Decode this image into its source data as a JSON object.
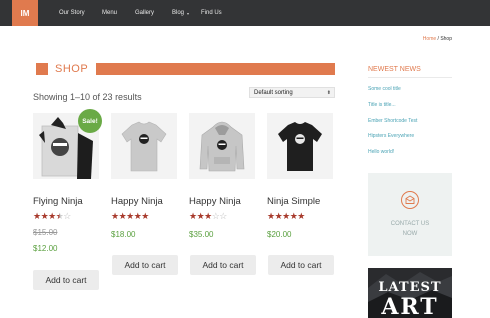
{
  "nav": {
    "logo": "IM",
    "items": [
      "Our Story",
      "Menu",
      "Gallery",
      "Blog",
      "Find Us"
    ],
    "blog_caret": "▾"
  },
  "breadcrumb": {
    "home": "Home",
    "sep": " / ",
    "current": "Shop"
  },
  "shop": {
    "title": "SHOP",
    "showing": "Showing 1–10 of 23 results",
    "sort_label": "Default sorting",
    "sort_arrow": "⬍",
    "sale_badge": "Sale!",
    "add_to_cart": "Add to cart"
  },
  "products": [
    {
      "name": "Flying Ninja",
      "rating": 3.5,
      "stars": "★★★",
      "half": "★",
      "empty": "☆",
      "old_price": "$15.00",
      "price": "$12.00"
    },
    {
      "name": "Happy Ninja",
      "rating": 5,
      "stars": "★★★★★",
      "half": "",
      "empty": "",
      "price": "$18.00"
    },
    {
      "name": "Happy Ninja",
      "rating": 3,
      "stars": "★★★",
      "half": "",
      "empty": "☆☆",
      "price": "$35.00"
    },
    {
      "name": "Ninja Simple",
      "rating": 5,
      "stars": "★★★★★",
      "half": "",
      "empty": "",
      "price": "$20.00"
    }
  ],
  "sidebar": {
    "news_title": "NEWEST NEWS",
    "links": [
      "Some cool title",
      "Title is title...",
      "Ember Shortcode Test",
      "Hipsters Everywhere",
      "Hello world!"
    ],
    "contact_line1": "CONTACT US",
    "contact_line2": "NOW",
    "art_line1": "LATEST",
    "art_line2": "ART"
  },
  "colors": {
    "accent": "#e07a4e",
    "nav_bg": "#333436",
    "price": "#5aa03f",
    "stars": "#a83a2c",
    "sale": "#6aaa46",
    "link": "#4aa3b5"
  }
}
